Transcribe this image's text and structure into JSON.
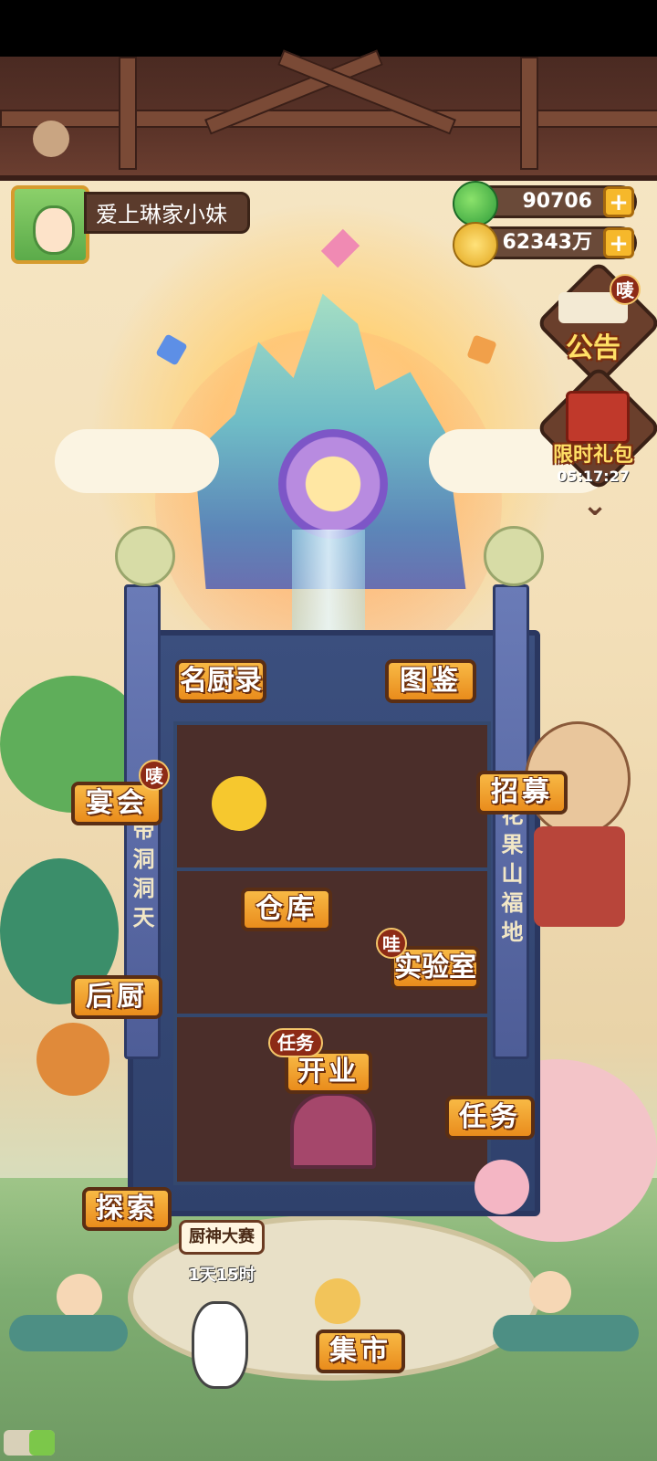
{
  "player": {
    "name": "爱上琳家小妹"
  },
  "resources": {
    "jade": "90706",
    "coins": "62343万"
  },
  "side_menu": {
    "notice_label": "公告",
    "notice_badge": "唛",
    "gift_label": "限时礼包",
    "gift_timer": "05:17:27"
  },
  "pillars": {
    "left_text": "帝洞洞天",
    "right_text": "花果山福地"
  },
  "buildings": {
    "chef_book": "名厨录",
    "catalog": "图鉴",
    "banquet": "宴会",
    "banquet_badge": "唛",
    "recruit": "招募",
    "warehouse": "仓库",
    "lab": "实验室",
    "lab_badge": "哇",
    "back_kitchen": "后厨",
    "open_business": "开业",
    "open_badge": "任务",
    "tasks": "任务",
    "explore": "探索",
    "market": "集市"
  },
  "event": {
    "contest_label": "厨神大赛",
    "contest_timer": "1天15时"
  },
  "colors": {
    "tag_orange": "#f3a535",
    "tag_border": "#5a2e14",
    "roof_brown": "#4a2a22",
    "tower_blue": "#3b4f7e"
  }
}
